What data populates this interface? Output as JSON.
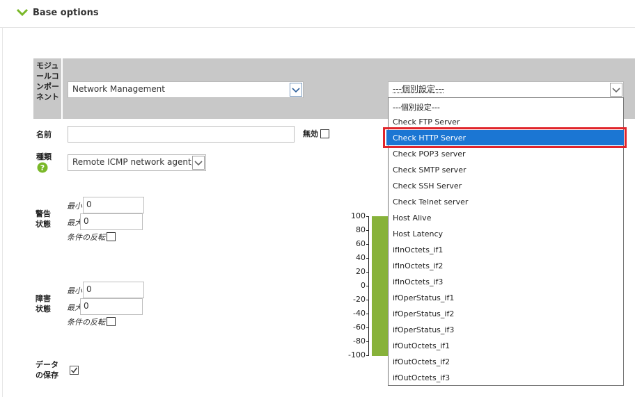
{
  "section": {
    "title": "Base options"
  },
  "module": {
    "label": "モジュールコンポーネント",
    "component_select": "Network Management",
    "individual_select": "---個別設定---",
    "options": [
      "---個別設定---",
      "Check FTP Server",
      "Check HTTP Server",
      "Check POP3 server",
      "Check SMTP server",
      "Check SSH Server",
      "Check Telnet server",
      "Host Alive",
      "Host Latency",
      "ifInOctets_if1",
      "ifInOctets_if2",
      "ifInOctets_if3",
      "ifOperStatus_if1",
      "ifOperStatus_if2",
      "ifOperStatus_if3",
      "ifOutOctets_if1",
      "ifOutOctets_if2",
      "ifOutOctets_if3"
    ],
    "highlighted_index": 2
  },
  "name": {
    "label": "名前",
    "value": "",
    "disabled_label": "無効"
  },
  "type": {
    "label": "種類",
    "value": "Remote ICMP network agent, b"
  },
  "warning": {
    "label": "警告状態",
    "min_label": "最小",
    "min_value": "0",
    "max_label": "最大",
    "max_value": "0",
    "invert_label": "条件の反転"
  },
  "critical": {
    "label": "障害状態",
    "min_label": "最小",
    "min_value": "0",
    "max_label": "最大",
    "max_value": "0",
    "invert_label": "条件の反転"
  },
  "history": {
    "label": "データの保存",
    "checked": true
  },
  "gauge": {
    "ticks": [
      "100",
      "80",
      "60",
      "40",
      "20",
      "0",
      "-20",
      "-40",
      "-60",
      "-80",
      "-100"
    ],
    "bar_color": "#87b23a"
  },
  "colors": {
    "accent": "#7ab829",
    "highlight": "#1b76d3",
    "highlight_border": "#e0252b",
    "band": "#c8c8c8"
  }
}
